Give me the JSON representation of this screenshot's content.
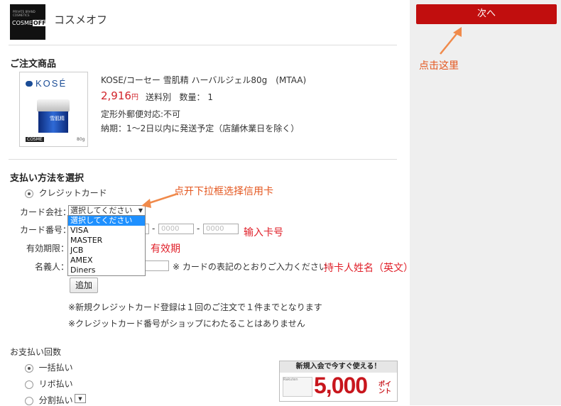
{
  "shop": {
    "logo_small": "PRIVATE BRAND COSMETICS",
    "logo_main": "COSME",
    "logo_accent": "OFF",
    "name": "コスメオフ"
  },
  "order": {
    "title": "ご注文商品",
    "product": {
      "brand_logo": "KOSÉ",
      "jar_label": "雪肌精",
      "badge": "COSME",
      "weight_label": "80g",
      "name": "KOSE/コーセー 雪肌精 ハーバルジェル80g　(MTAA)",
      "price": "2,916",
      "currency": "円",
      "shipping": "送料別",
      "qty_label": "数量：",
      "qty": "1",
      "note1": "定形外郵便対応:不可",
      "note2": "納期：1～2日以内に発送予定（店舗休業日を除く）"
    }
  },
  "payment": {
    "title": "支払い方法を選択",
    "method": "クレジットカード",
    "card_company_label": "カード会社：",
    "card_select_value": "選択してください",
    "card_options": [
      "選択してください",
      "VISA",
      "MASTER",
      "JCB",
      "AMEX",
      "Diners"
    ],
    "card_number_label": "カード番号：",
    "card_placeholder": "0000",
    "dash": "-",
    "expiry_label": "有効期限：",
    "holder_label": "名義人：",
    "holder_note": "※ カードの表記のとおりご入力ください",
    "add_button": "追加",
    "note1": "※新規クレジットカード登録は１回のご注文で１件までとなります",
    "note2": "※クレジットカード番号がショップにわたることはありません"
  },
  "installments": {
    "title": "お支払い回数",
    "options": [
      "一括払い",
      "リボ払い",
      "分割払い"
    ],
    "selected": 0
  },
  "banner": {
    "headline": "新規入会で今すぐ使える！",
    "amount": "5,000",
    "unit": "ポイント",
    "card_text": "Rakuten"
  },
  "sidebar": {
    "next_button": "次へ"
  },
  "annotations": {
    "click_here": "点击这里",
    "open_dropdown": "点开下拉框选择信用卡",
    "enter_card_number": "输入卡号",
    "expiry": "有效期",
    "holder_name": "持卡人姓名（英文）"
  },
  "colors": {
    "accent_red": "#c10e0e",
    "price_red": "#d1232a",
    "annotation_orange": "#e4561e",
    "dropdown_highlight": "#1e90ff"
  }
}
